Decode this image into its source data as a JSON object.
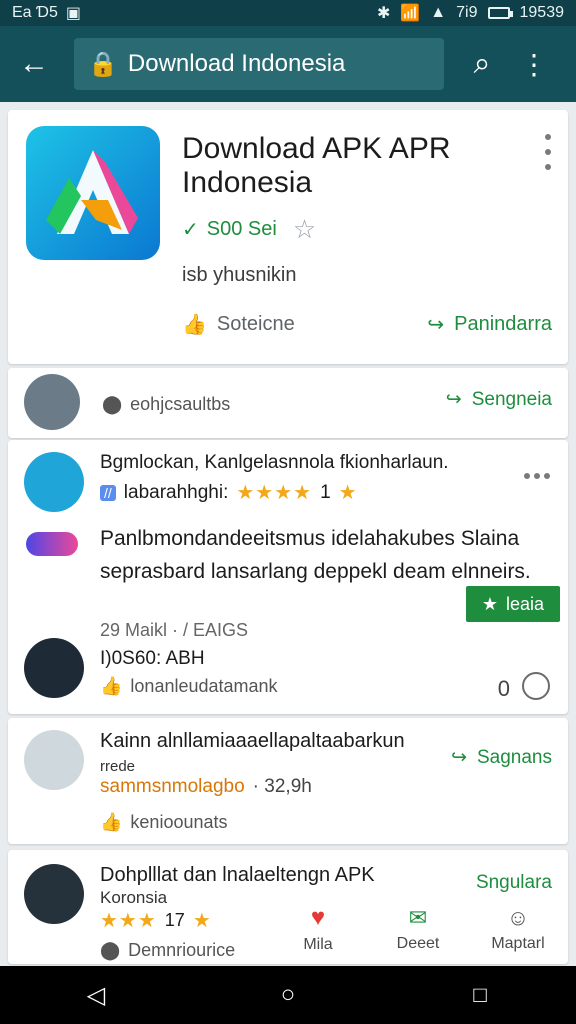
{
  "status": {
    "left_text": "Ea Ɗ5",
    "right_text": "7i9",
    "time": "19539"
  },
  "appbar": {
    "url_text": "Download Indonesia"
  },
  "app_card": {
    "title": "Download APK APR Indonesia",
    "rating_text": "S00 Sei",
    "subtitle": "isb yhusnikin",
    "action_left": "Soteicne",
    "action_right": "Panindarra"
  },
  "user_row_1": {
    "label": "eohjcsaultbs",
    "action": "Sengneia"
  },
  "review_1": {
    "name": "Bgmlockan, Kanlgelasnnola fkionharlaun.",
    "subline_label": "labarahhghi:",
    "stars": "★★★★",
    "rating": "1",
    "body": "Panlbmondandeeitsmus idelahakubes Slaina seprasbard lansarlang  deppekl  deam elnneirs.",
    "meta": "29 Maikl · / EAIGS",
    "cta": "leaia",
    "device_label": "I)0S60: ABH",
    "device_action": "lonanleudatamank",
    "count": "0"
  },
  "card_2": {
    "title": "Kainn alnllamiaaaellapaltaabarkun",
    "subtitle": "rrede",
    "line": "sammsnmolagbo",
    "line_suffix": "· 32,9h",
    "action": "Sagnans",
    "sub_action": "kenioounats"
  },
  "card_3": {
    "title": "Dohplllat dan lnalaeltengn APK",
    "subtitle": "Koronsia",
    "stars": "★★★",
    "rating": "17",
    "label": "Demnriourice",
    "action": "Sngulara"
  },
  "bottom_nav": {
    "items": [
      {
        "label": "Mila",
        "icon": "heart-icon"
      },
      {
        "label": "Deeet",
        "icon": "message-icon"
      },
      {
        "label": "Maptarl",
        "icon": "profile-icon"
      }
    ]
  },
  "colors": {
    "appbar": "#14505a",
    "status": "#0f3f48",
    "accent_green": "#1e8e3e"
  }
}
